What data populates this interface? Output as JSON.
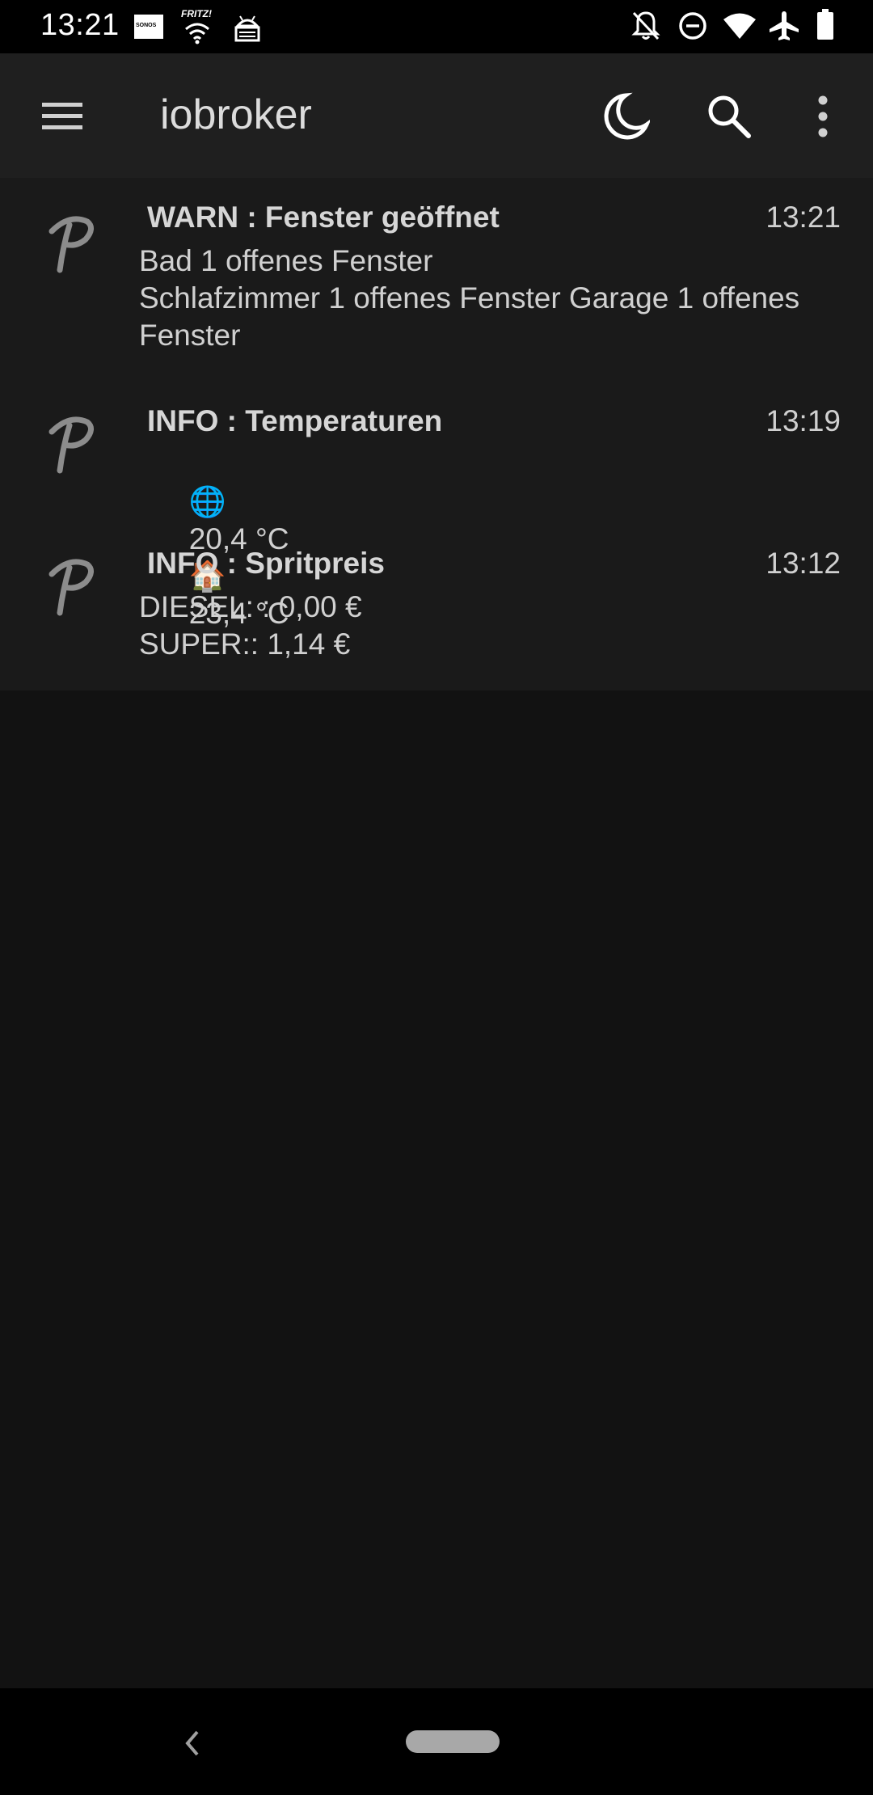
{
  "status_bar": {
    "time": "13:21",
    "left_icons": [
      "sonos-icon",
      "fritz-wifi-icon",
      "android-debug-icon"
    ],
    "right_icons": [
      "bell-off-icon",
      "do-not-disturb-icon",
      "wifi-icon",
      "airplane-icon",
      "battery-icon"
    ],
    "sonos_label": "SONOS",
    "fritz_label": "FRITZ!"
  },
  "app_bar": {
    "title": "iobroker",
    "menu_icon": "hamburger-menu-icon",
    "night_mode_icon": "moon-icon",
    "search_icon": "search-icon",
    "overflow_icon": "more-vert-icon"
  },
  "notifications": [
    {
      "icon": "p-logo-icon",
      "title": "WARN : Fenster geöffnet",
      "time": "13:21",
      "body": "Bad 1 offenes Fenster\nSchlafzimmer 1 offenes Fenster Garage 1 offenes Fenster"
    },
    {
      "icon": "p-logo-icon",
      "title": "INFO : Temperaturen",
      "time": "13:19",
      "body_globe": "🌐",
      "body_outdoor": "20,4 °C",
      "body_house": "🏠",
      "body_indoor": "23,4 °C"
    },
    {
      "icon": "p-logo-icon",
      "title": "INFO : Spritpreis",
      "time": "13:12",
      "body": "DIESEL: : 0,00 €\nSUPER:: 1,14 €"
    }
  ],
  "nav_bar": {
    "back_icon": "back-chevron-icon",
    "home_icon": "home-pill-icon"
  },
  "colors": {
    "background": "#121212",
    "app_bar": "#1f1f1f",
    "list_background": "#1a1a1a",
    "text": "#d0d0d0",
    "status_bar": "#000000"
  }
}
